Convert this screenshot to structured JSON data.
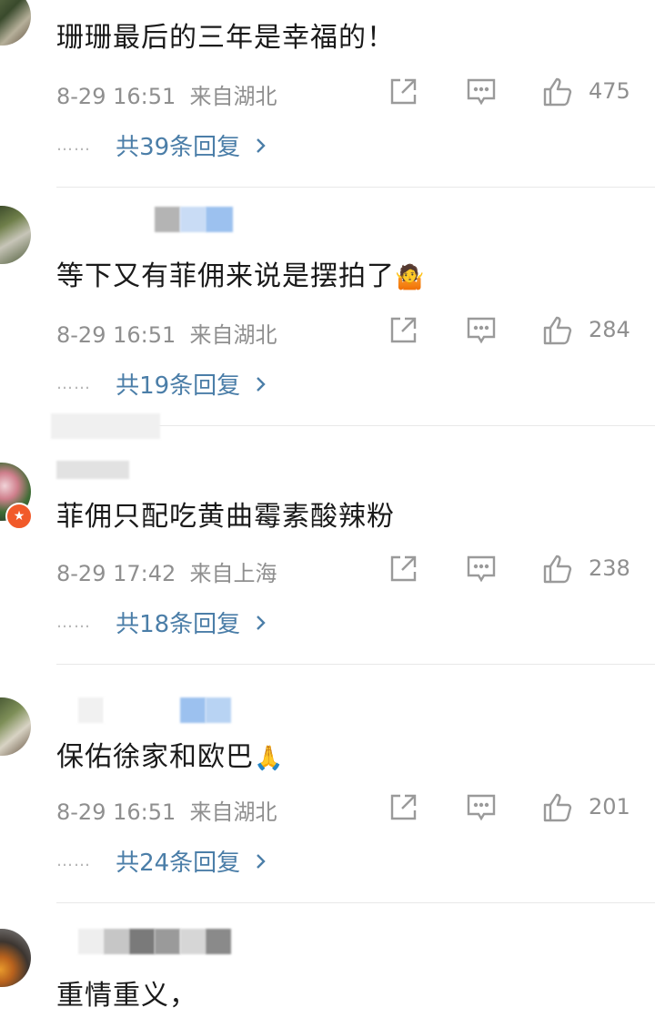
{
  "comments": [
    {
      "text": "珊珊最后的三年是幸福的！",
      "date": "8-29 16:51",
      "location": "来自湖北",
      "likes": "475",
      "replies": "共39条回复",
      "dots": "……"
    },
    {
      "text": "等下又有菲佣来说是摆拍了",
      "emoji": "🤷",
      "date": "8-29 16:51",
      "location": "来自湖北",
      "likes": "284",
      "replies": "共19条回复",
      "dots": "……"
    },
    {
      "text": "菲佣只配吃黄曲霉素酸辣粉",
      "date": "8-29 17:42",
      "location": "来自上海",
      "likes": "238",
      "replies": "共18条回复",
      "dots": "……"
    },
    {
      "text": "保佑徐家和欧巴",
      "emoji": "🙏",
      "date": "8-29 16:51",
      "location": "来自湖北",
      "likes": "201",
      "replies": "共24条回复",
      "dots": "……"
    },
    {
      "text": "重情重义，"
    }
  ],
  "icons": {
    "share": "share-icon",
    "comment": "comment-icon",
    "like": "thumbs-up-icon",
    "chevron": "chevron-right-icon",
    "verified": "verified-badge-icon"
  },
  "colors": {
    "reply_link": "#4b7ea8",
    "meta": "#8f8f8f",
    "badge": "#f15a2a"
  }
}
